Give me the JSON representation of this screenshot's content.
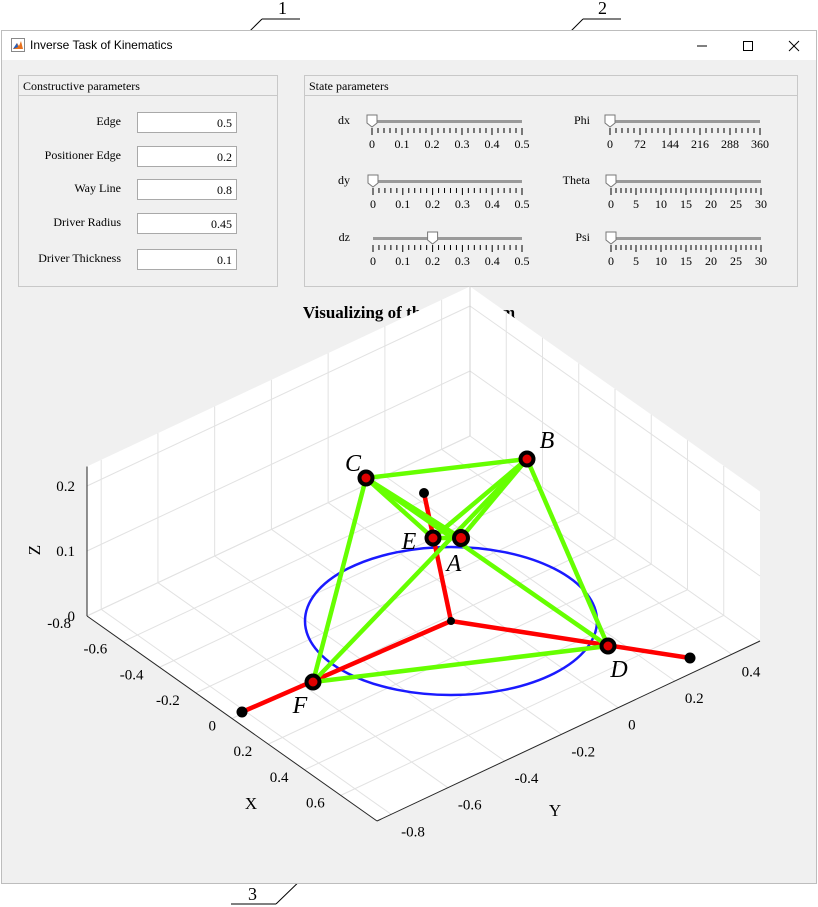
{
  "window": {
    "title": "Inverse Task of Kinematics",
    "minimize_glyph": "—",
    "maximize_glyph": "☐",
    "close_glyph": "✕"
  },
  "callouts": [
    "1",
    "2",
    "3"
  ],
  "constructive": {
    "title": "Constructive parameters",
    "fields": [
      {
        "label": "Edge",
        "value": "0.5"
      },
      {
        "label": "Positioner Edge",
        "value": "0.2"
      },
      {
        "label": "Way Line",
        "value": "0.8"
      },
      {
        "label": "Driver Radius",
        "value": "0.45"
      },
      {
        "label": "Driver Thickness",
        "value": "0.1"
      }
    ]
  },
  "state": {
    "title": "State parameters",
    "sliders": [
      {
        "label": "dx",
        "ticks": [
          "0",
          "0.1",
          "0.2",
          "0.3",
          "0.4",
          "0.5"
        ],
        "min": 0,
        "max": 0.5,
        "value": 0
      },
      {
        "label": "dy",
        "ticks": [
          "0",
          "0.1",
          "0.2",
          "0.3",
          "0.4",
          "0.5"
        ],
        "min": 0,
        "max": 0.5,
        "value": 0
      },
      {
        "label": "dz",
        "ticks": [
          "0",
          "0.1",
          "0.2",
          "0.3",
          "0.4",
          "0.5"
        ],
        "min": 0,
        "max": 0.5,
        "value": 0.2
      },
      {
        "label": "Phi",
        "ticks": [
          "0",
          "72",
          "144",
          "216",
          "288",
          "360"
        ],
        "min": 0,
        "max": 360,
        "value": 0
      },
      {
        "label": "Theta",
        "ticks": [
          "0",
          "5",
          "10",
          "15",
          "20",
          "25",
          "30"
        ],
        "min": 0,
        "max": 30,
        "value": 0
      },
      {
        "label": "Psi",
        "ticks": [
          "0",
          "5",
          "10",
          "15",
          "20",
          "25",
          "30"
        ],
        "min": 0,
        "max": 30,
        "value": 0
      }
    ]
  },
  "plot": {
    "title": "Visualizing of the mechanism",
    "xlabel": "X",
    "ylabel": "Y",
    "zlabel": "Z",
    "x_ticks": [
      "-0.8",
      "-0.6",
      "-0.4",
      "-0.2",
      "0",
      "0.2",
      "0.4",
      "0.6"
    ],
    "y_ticks": [
      "-0.8",
      "-0.6",
      "-0.4",
      "-0.2",
      "0",
      "0.2",
      "0.4"
    ],
    "z_ticks": [
      "0",
      "0.1",
      "0.2"
    ],
    "point_labels": [
      "A",
      "B",
      "C",
      "D",
      "E",
      "F"
    ],
    "colors": {
      "links": "#ff0000",
      "platform": "#66ff00",
      "circle": "#1a1aff",
      "joints": "#000000"
    }
  }
}
